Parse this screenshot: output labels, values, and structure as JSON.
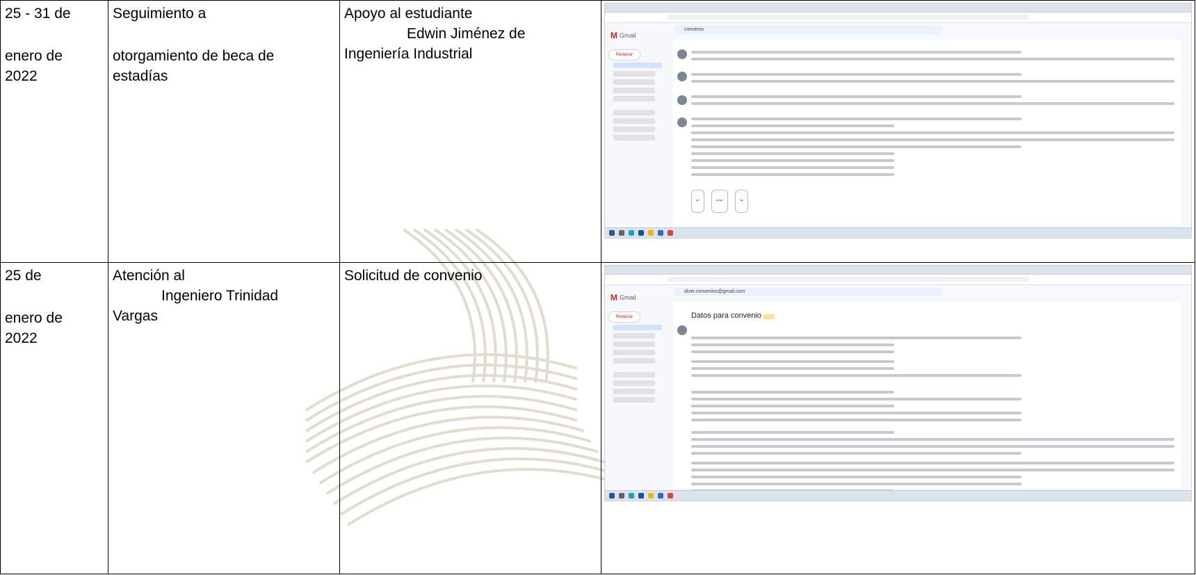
{
  "rows": [
    {
      "date": [
        "25 - 31 de",
        "enero de",
        "2022"
      ],
      "activity": [
        "Seguimiento a",
        "otorgamiento de beca de",
        "estadías"
      ],
      "description": [
        "Apoyo al estudiante",
        "Edwin Jiménez de",
        "Ingeniería Industrial"
      ],
      "screenshot": {
        "app_name": "Gmail",
        "compose_label": "Redactar",
        "search_text": "convenio"
      }
    },
    {
      "date": [
        "25 de",
        "enero de",
        "2022"
      ],
      "activity": [
        "Atención al",
        "Ingeniero Trinidad",
        "Vargas"
      ],
      "description": [
        "Solicitud de convenio"
      ],
      "screenshot": {
        "app_name": "Gmail",
        "compose_label": "Redactar",
        "search_text": "diver.convenios@gmail.com",
        "subject": "Datos para convenio"
      }
    }
  ],
  "colors": {
    "watermark": "#c9bfae",
    "border": "#000000"
  }
}
